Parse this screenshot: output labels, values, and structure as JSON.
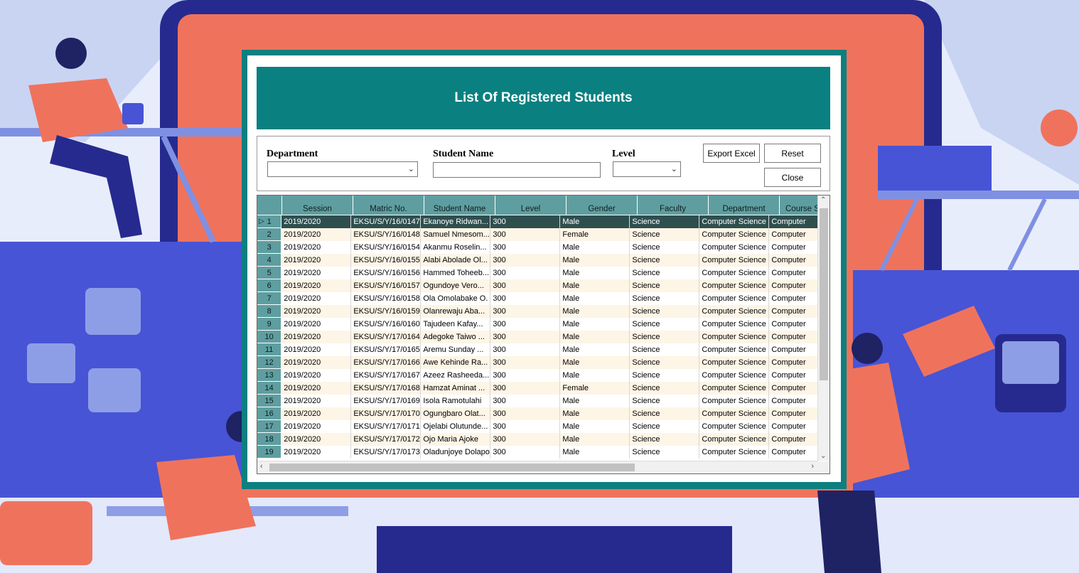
{
  "window": {
    "title": "List Of Registered Students"
  },
  "filters": {
    "department_label": "Department",
    "department_value": "",
    "student_name_label": "Student Name",
    "student_name_value": "",
    "level_label": "Level",
    "level_value": ""
  },
  "buttons": {
    "export": "Export Excel",
    "reset": "Reset",
    "close": "Close"
  },
  "grid": {
    "columns": [
      "",
      "Session",
      "Matric No.",
      "Student Name",
      "Level",
      "Gender",
      "Faculty",
      "Department",
      "Course S"
    ],
    "selected_row": 1,
    "rows": [
      [
        "1",
        "2019/2020",
        "EKSU/S/Y/16/0147",
        "Ekanoye Ridwan...",
        "300",
        "Male",
        "Science",
        "Computer Science",
        "Computer"
      ],
      [
        "2",
        "2019/2020",
        "EKSU/S/Y/16/0148",
        "Samuel Nmesom...",
        "300",
        "Female",
        "Science",
        "Computer Science",
        "Computer"
      ],
      [
        "3",
        "2019/2020",
        "EKSU/S/Y/16/0154",
        "Akanmu Roselin...",
        "300",
        "Male",
        "Science",
        "Computer Science",
        "Computer"
      ],
      [
        "4",
        "2019/2020",
        "EKSU/S/Y/16/0155",
        "Alabi Abolade Ol...",
        "300",
        "Male",
        "Science",
        "Computer Science",
        "Computer"
      ],
      [
        "5",
        "2019/2020",
        "EKSU/S/Y/16/0156",
        "Hammed Toheeb...",
        "300",
        "Male",
        "Science",
        "Computer Science",
        "Computer"
      ],
      [
        "6",
        "2019/2020",
        "EKSU/S/Y/16/0157",
        "Ogundoye Vero...",
        "300",
        "Male",
        "Science",
        "Computer Science",
        "Computer"
      ],
      [
        "7",
        "2019/2020",
        "EKSU/S/Y/16/0158",
        "Ola Omolabake O.",
        "300",
        "Male",
        "Science",
        "Computer Science",
        "Computer"
      ],
      [
        "8",
        "2019/2020",
        "EKSU/S/Y/16/0159",
        "Olanrewaju Aba...",
        "300",
        "Male",
        "Science",
        "Computer Science",
        "Computer"
      ],
      [
        "9",
        "2019/2020",
        "EKSU/S/Y/16/0160",
        "Tajudeen Kafay...",
        "300",
        "Male",
        "Science",
        "Computer Science",
        "Computer"
      ],
      [
        "10",
        "2019/2020",
        "EKSU/S/Y/17/0164",
        "Adegoke Taiwo ...",
        "300",
        "Male",
        "Science",
        "Computer Science",
        "Computer"
      ],
      [
        "11",
        "2019/2020",
        "EKSU/S/Y/17/0165",
        "Aremu Sunday ...",
        "300",
        "Male",
        "Science",
        "Computer Science",
        "Computer"
      ],
      [
        "12",
        "2019/2020",
        "EKSU/S/Y/17/0166",
        "Awe Kehinde Ra...",
        "300",
        "Male",
        "Science",
        "Computer Science",
        "Computer"
      ],
      [
        "13",
        "2019/2020",
        "EKSU/S/Y/17/0167",
        "Azeez Rasheeda...",
        "300",
        "Male",
        "Science",
        "Computer Science",
        "Computer"
      ],
      [
        "14",
        "2019/2020",
        "EKSU/S/Y/17/0168",
        "Hamzat Aminat ...",
        "300",
        "Female",
        "Science",
        "Computer Science",
        "Computer"
      ],
      [
        "15",
        "2019/2020",
        "EKSU/S/Y/17/0169",
        "Isola Ramotulahi",
        "300",
        "Male",
        "Science",
        "Computer Science",
        "Computer"
      ],
      [
        "16",
        "2019/2020",
        "EKSU/S/Y/17/0170",
        "Ogungbaro Olat...",
        "300",
        "Male",
        "Science",
        "Computer Science",
        "Computer"
      ],
      [
        "17",
        "2019/2020",
        "EKSU/S/Y/17/0171",
        "Ojelabi Olutunde...",
        "300",
        "Male",
        "Science",
        "Computer Science",
        "Computer"
      ],
      [
        "18",
        "2019/2020",
        "EKSU/S/Y/17/0172",
        "Ojo Maria Ajoke",
        "300",
        "Male",
        "Science",
        "Computer Science",
        "Computer"
      ],
      [
        "19",
        "2019/2020",
        "EKSU/S/Y/17/0173",
        "Oladunjoye Dolapo",
        "300",
        "Male",
        "Science",
        "Computer Science",
        "Computer"
      ]
    ]
  },
  "colors": {
    "dialog_frame": "#0e7f7f",
    "banner": "#0a8080",
    "grid_header": "#5f9ea0",
    "selected_row": "#2f4f4f",
    "alt_row": "#fdf5e6"
  },
  "icons": {
    "row_pointer": "triangle-right-icon",
    "dropdown": "chevron-down-icon",
    "scroll_up": "chevron-up-icon",
    "scroll_down": "chevron-down-icon",
    "scroll_left": "chevron-left-icon",
    "scroll_right": "chevron-right-icon"
  }
}
